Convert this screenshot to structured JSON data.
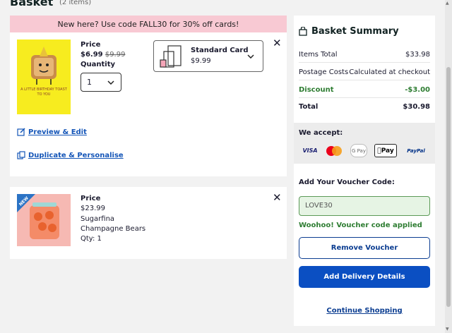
{
  "page": {
    "title": "Basket",
    "item_count": "(2 items)"
  },
  "promo": {
    "text": "New here? Use code FALL30 for 30% off cards!"
  },
  "items": [
    {
      "price_label": "Price",
      "price": "$6.99",
      "old_price": "$9.99",
      "quantity_label": "Quantity",
      "quantity": "1",
      "thumb_text": "A LITTLE BIRTHDAY TOAST TO YOU",
      "card_option": {
        "name": "Standard Card",
        "price": "$9.99"
      },
      "preview_label": "Preview & Edit",
      "duplicate_label": "Duplicate & Personalise"
    },
    {
      "badge": "NEW",
      "price_label": "Price",
      "price": "$23.99",
      "name_line1": "Sugarfina",
      "name_line2": "Champagne Bears",
      "qty": "Qty: 1"
    }
  ],
  "summary": {
    "title": "Basket Summary",
    "rows": [
      {
        "label": "Items Total",
        "value": "$33.98"
      },
      {
        "label": "Postage Costs",
        "value": "Calculated at checkout"
      },
      {
        "label": "Discount",
        "value": "-$3.00"
      },
      {
        "label": "Total",
        "value": "$30.98"
      }
    ],
    "accept_label": "We accept:",
    "payments": [
      "VISA",
      "Mastercard",
      "G Pay",
      "Pay",
      "PayPal"
    ],
    "voucher_label": "Add Your Voucher Code:",
    "voucher_value": "LOVE30",
    "voucher_success": "Woohoo! Voucher code applied",
    "remove_voucher": "Remove Voucher",
    "add_delivery": "Add Delivery Details",
    "continue": "Continue Shopping"
  },
  "colors": {
    "accent": "#0b4fc2",
    "promo_bg": "#f8c9d3",
    "discount": "#2e7d32"
  }
}
